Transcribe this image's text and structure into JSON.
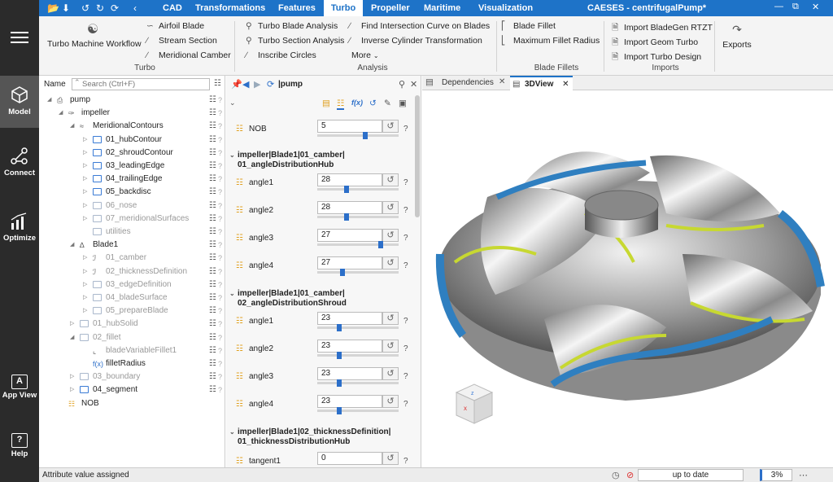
{
  "app": {
    "title": "CAESES - centrifugalPump*"
  },
  "menu": {
    "tabs": [
      "CAD",
      "Transformations",
      "Features",
      "Turbo",
      "Propeller",
      "Maritime",
      "Visualization"
    ],
    "active": "Turbo"
  },
  "leftbar": {
    "items": [
      "Model",
      "Connect",
      "Optimize",
      "App View",
      "Help"
    ]
  },
  "ribbon": {
    "turbo_workflow": "Turbo Machine Workflow",
    "airfoil_blade": "Airfoil Blade",
    "stream_section": "Stream Section",
    "meridional_camber": "Meridional Camber",
    "turbo_group": "Turbo",
    "turbo_blade_analysis": "Turbo Blade Analysis",
    "turbo_section_analysis": "Turbo Section Analysis",
    "inscribe_circles": "Inscribe Circles",
    "find_intersection": "Find Intersection Curve on Blades",
    "inverse_cylinder": "Inverse Cylinder Transformation",
    "more": "More",
    "analysis_group": "Analysis",
    "blade_fillet": "Blade Fillet",
    "max_fillet_radius": "Maximum Fillet Radius",
    "fillets_group": "Blade Fillets",
    "import_bladegen": "Import BladeGen RTZT",
    "import_geom_turbo": "Import Geom Turbo",
    "import_turbo_design": "Import Turbo Design",
    "imports_group": "Imports",
    "exports": "Exports"
  },
  "tree": {
    "name_label": "Name",
    "search_placeholder": "Search (Ctrl+F)",
    "rows": [
      {
        "label": "pump",
        "indent": 0
      },
      {
        "label": "impeller",
        "indent": 1
      },
      {
        "label": "MeridionalContours",
        "indent": 2
      },
      {
        "label": "01_hubContour",
        "indent": 3
      },
      {
        "label": "02_shroudContour",
        "indent": 3
      },
      {
        "label": "03_leadingEdge",
        "indent": 3
      },
      {
        "label": "04_trailingEdge",
        "indent": 3
      },
      {
        "label": "05_backdisc",
        "indent": 3
      },
      {
        "label": "06_nose",
        "indent": 3
      },
      {
        "label": "07_meridionalSurfaces",
        "indent": 3
      },
      {
        "label": "utilities",
        "indent": 3
      },
      {
        "label": "Blade1",
        "indent": 2
      },
      {
        "label": "01_camber",
        "indent": 3
      },
      {
        "label": "02_thicknessDefinition",
        "indent": 3
      },
      {
        "label": "03_edgeDefinition",
        "indent": 3
      },
      {
        "label": "04_bladeSurface",
        "indent": 3
      },
      {
        "label": "05_prepareBlade",
        "indent": 3
      },
      {
        "label": "01_hubSolid",
        "indent": 2
      },
      {
        "label": "02_fillet",
        "indent": 2
      },
      {
        "label": "bladeVariableFillet1",
        "indent": 3
      },
      {
        "label": "filletRadius",
        "indent": 3
      },
      {
        "label": "03_boundary",
        "indent": 2
      },
      {
        "label": "04_segment",
        "indent": 2
      },
      {
        "label": "NOB",
        "indent": 1
      }
    ]
  },
  "props": {
    "path": "|pump",
    "nob_label": "NOB",
    "nob_value": "5",
    "nob_level": 0.6,
    "section1": "impeller|Blade1|01_camber|\n01_angleDistributionHub",
    "hub": [
      {
        "label": "angle1",
        "value": "28",
        "level": 0.35
      },
      {
        "label": "angle2",
        "value": "28",
        "level": 0.35
      },
      {
        "label": "angle3",
        "value": "27",
        "level": 0.8
      },
      {
        "label": "angle4",
        "value": "27",
        "level": 0.3
      }
    ],
    "section2": "impeller|Blade1|01_camber|\n02_angleDistributionShroud",
    "shroud": [
      {
        "label": "angle1",
        "value": "23",
        "level": 0.25
      },
      {
        "label": "angle2",
        "value": "23",
        "level": 0.25
      },
      {
        "label": "angle3",
        "value": "23",
        "level": 0.25
      },
      {
        "label": "angle4",
        "value": "23",
        "level": 0.25
      }
    ],
    "section3": "impeller|Blade1|02_thicknessDefinition|\n01_thicknessDistributionHub",
    "tangent_label": "tangent1",
    "tangent_value": "0"
  },
  "view": {
    "tabs": [
      "Dependencies",
      "3DView"
    ],
    "active": "3DView"
  },
  "status": {
    "message": "Attribute value assigned",
    "state": "up to date",
    "zoom": "3%"
  },
  "colors": {
    "accent": "#1e73c8",
    "sidebar": "#2b2b2b",
    "fillet": "#c7d831",
    "blade_edge": "#2f7fc0"
  }
}
